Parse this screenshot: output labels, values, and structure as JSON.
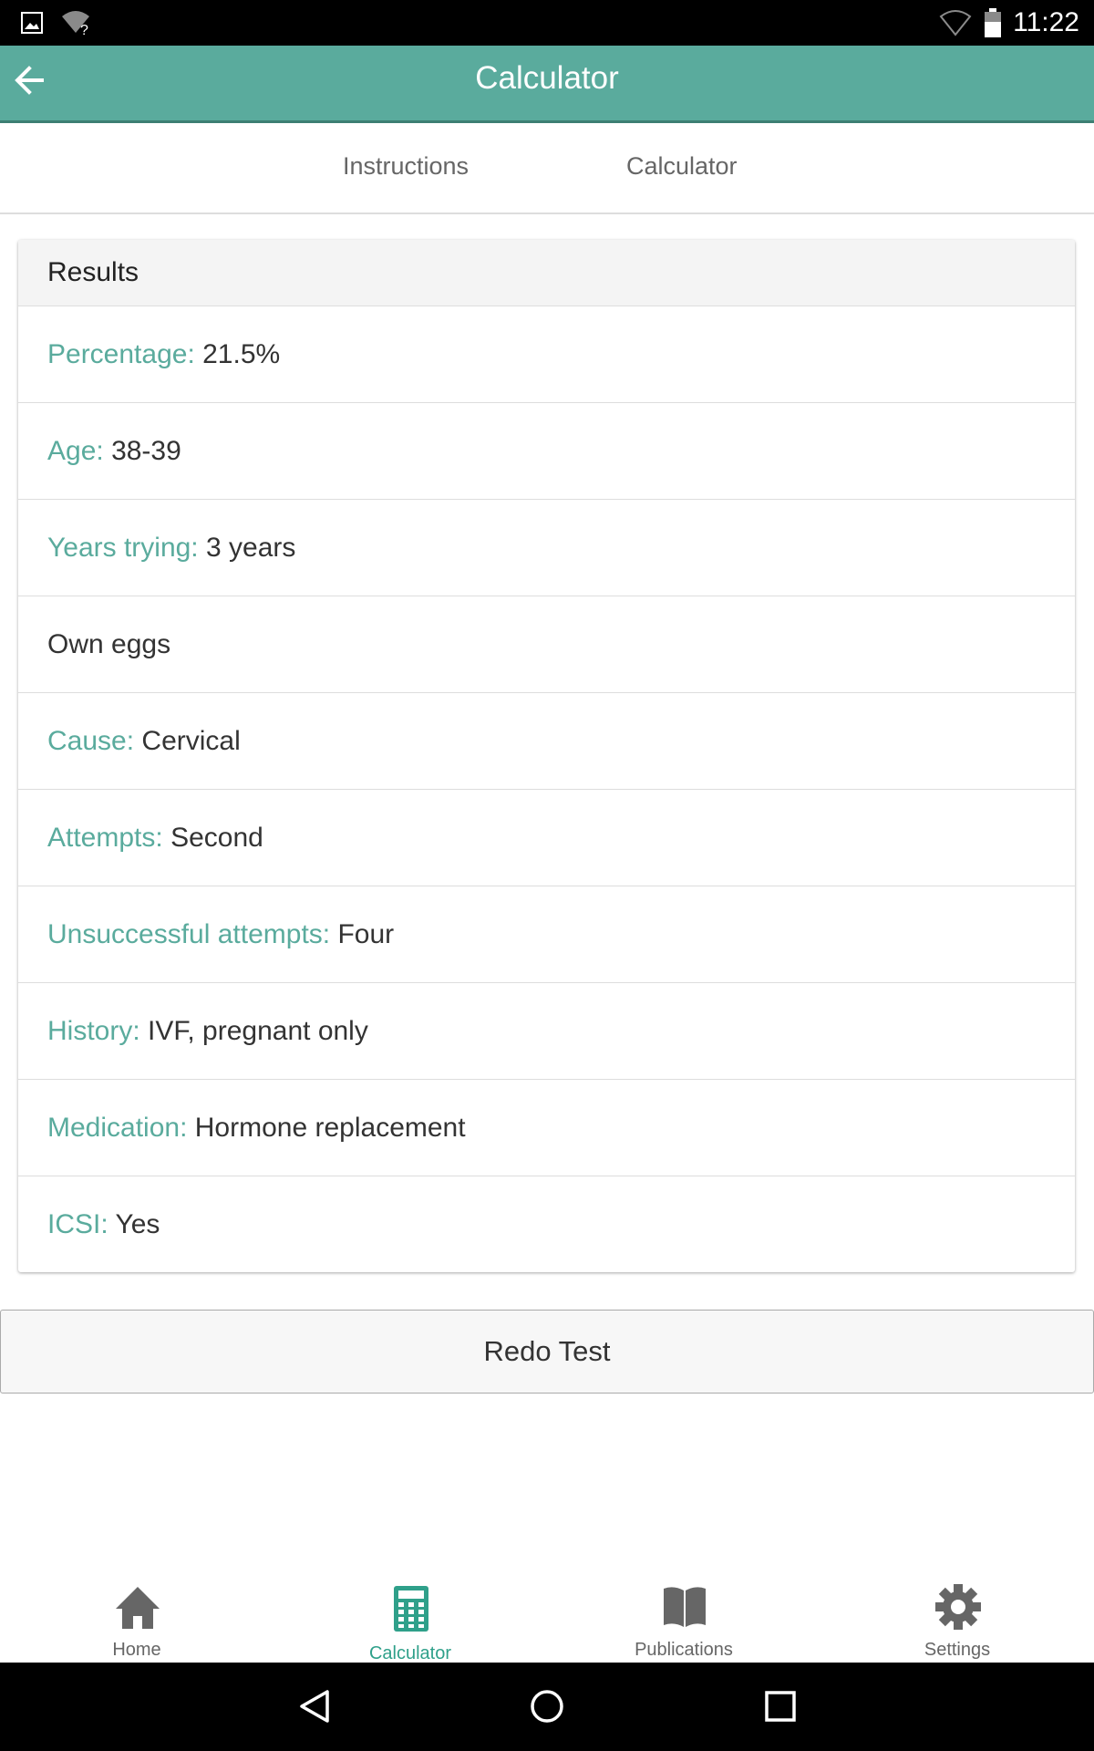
{
  "status_bar": {
    "time": "11:22",
    "icons": [
      "image-notification-icon",
      "wifi-unknown-icon",
      "wifi-signal-icon",
      "battery-icon"
    ]
  },
  "app_bar": {
    "title": "Calculator",
    "back_icon": "arrow-left-icon",
    "background_color": "#5aab9d"
  },
  "tabs": [
    {
      "label": "Instructions"
    },
    {
      "label": "Calculator"
    }
  ],
  "results": {
    "header": "Results",
    "rows": [
      {
        "label": "Percentage:",
        "value": "21.5%"
      },
      {
        "label": "Age:",
        "value": "38-39"
      },
      {
        "label": "Years trying:",
        "value": "3 years"
      },
      {
        "label": "",
        "value": "Own eggs"
      },
      {
        "label": "Cause:",
        "value": "Cervical"
      },
      {
        "label": "Attempts:",
        "value": "Second"
      },
      {
        "label": "Unsuccessful attempts:",
        "value": "Four"
      },
      {
        "label": "History:",
        "value": "IVF, pregnant only"
      },
      {
        "label": "Medication:",
        "value": "Hormone replacement"
      },
      {
        "label": "ICSI:",
        "value": "Yes"
      }
    ]
  },
  "redo_button": {
    "label": "Redo Test"
  },
  "bottom_nav": {
    "active": "Calculator",
    "items": [
      {
        "label": "Home",
        "icon": "home-icon"
      },
      {
        "label": "Calculator",
        "icon": "calculator-icon"
      },
      {
        "label": "Publications",
        "icon": "book-icon"
      },
      {
        "label": "Settings",
        "icon": "gear-icon"
      }
    ]
  },
  "system_nav": {
    "icons": [
      "back-triangle-icon",
      "home-circle-icon",
      "recents-square-icon"
    ]
  },
  "colors": {
    "accent": "#5aab9d",
    "active_nav": "#2fa08a",
    "inactive_nav": "#666666"
  }
}
